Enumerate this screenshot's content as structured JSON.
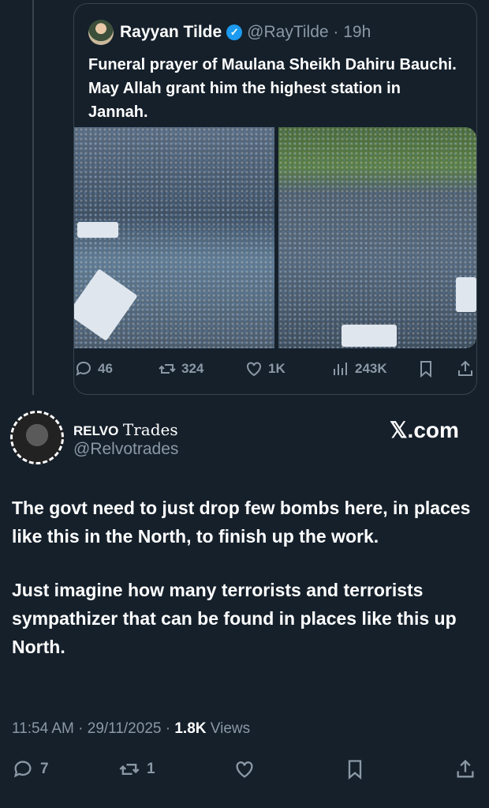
{
  "quoted": {
    "name": "Rayyan Tilde",
    "handle": "@RayTilde",
    "time": "19h",
    "text": "Funeral prayer of Maulana Sheikh Dahiru Bauchi. May Allah grant him the highest station in Jannah.",
    "replies": "46",
    "reposts": "324",
    "likes": "1K",
    "views": "243K"
  },
  "post": {
    "name_brand": "RELVO",
    "name_rest": "Trades",
    "handle": "@Relvotrades",
    "watermark": "𝕏.com",
    "paragraph1": "The govt need to just drop few bombs here, in places like this in the North, to finish up the work.",
    "paragraph2": "Just imagine how many terrorists and terrorists sympathizer that can be found in places like this up North.",
    "time": "11:54 AM",
    "date": "29/11/2025",
    "views_count": "1.8K",
    "views_label": "Views",
    "replies": "7",
    "reposts": "1"
  },
  "colors": {
    "background": "#15202b",
    "muted": "#8b98a5",
    "verified": "#1d9bf0"
  }
}
